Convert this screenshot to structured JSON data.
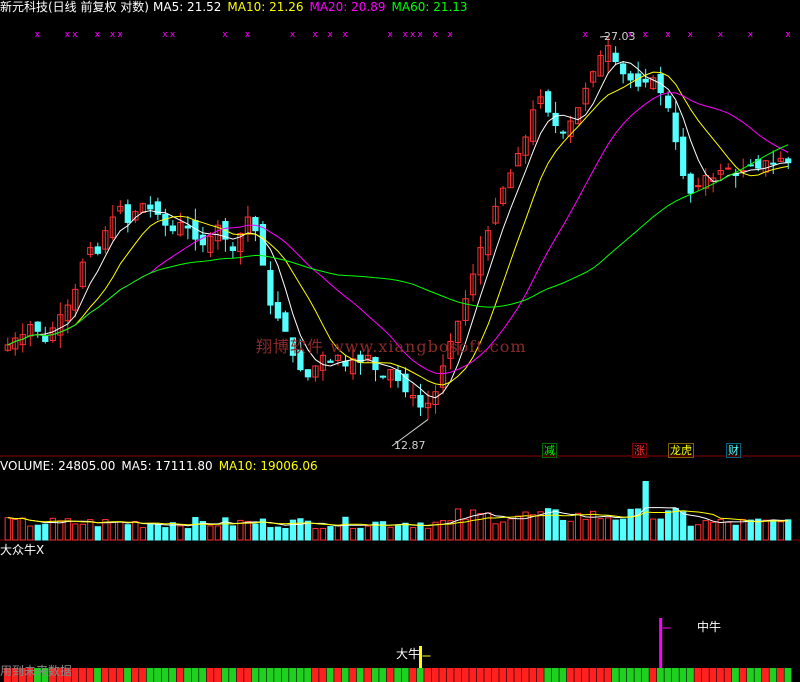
{
  "header": {
    "title": "新元科技(日线 前复权 对数)",
    "ma5": "MA5: 21.52",
    "ma10": "MA10: 21.26",
    "ma20": "MA20: 20.89",
    "ma60": "MA60: 21.13"
  },
  "colors": {
    "up": "#ff3232",
    "down": "#54ffff",
    "ma5": "#ffffff",
    "ma10": "#ffff00",
    "ma20": "#ff00ff",
    "ma60": "#00ff00",
    "signal_x": "#ff00ff",
    "bg": "#000000",
    "grid": "#8b0000"
  },
  "annotations": {
    "high_label": "27.03",
    "low_label": "12.87",
    "events": [
      "减",
      "涨",
      "龙虎",
      "财"
    ]
  },
  "watermark": "翔博软件 www.xiangbosoft.com",
  "volume_header": {
    "volume": "VOLUME: 24805.00",
    "ma5": "MA5: 17111.80",
    "ma10": "MA10: 19006.06"
  },
  "indicator": {
    "title": "大众牛X",
    "signal1": "大牛",
    "signal2": "中牛",
    "bottom_left": "用到未来数据"
  },
  "chart_data": {
    "type": "candlestick",
    "price_range": [
      12.87,
      27.03
    ],
    "price_scale": "log",
    "close_series": [
      15.2,
      15.4,
      15.5,
      15.8,
      15.6,
      15.3,
      15.7,
      16.1,
      16.4,
      16.9,
      17.8,
      18.3,
      18.1,
      18.9,
      19.4,
      19.8,
      19.2,
      19.6,
      19.9,
      19.7,
      19.5,
      19.1,
      18.9,
      19.2,
      19.0,
      18.6,
      18.4,
      18.7,
      19.1,
      18.6,
      18.2,
      18.8,
      19.4,
      18.9,
      17.7,
      16.4,
      16.0,
      15.6,
      14.9,
      14.5,
      14.3,
      14.6,
      14.9,
      14.7,
      14.9,
      14.6,
      14.8,
      14.7,
      14.9,
      14.5,
      14.3,
      14.5,
      14.2,
      13.9,
      13.8,
      13.5,
      13.6,
      13.9,
      14.6,
      15.3,
      15.9,
      16.6,
      17.4,
      18.3,
      18.9,
      19.8,
      20.5,
      21.1,
      21.9,
      22.6,
      23.8,
      24.4,
      23.7,
      23.1,
      22.8,
      23.3,
      23.9,
      24.8,
      25.6,
      26.4,
      26.9,
      26.1,
      25.5,
      25.2,
      24.9,
      25.1,
      25.3,
      24.6,
      23.9,
      22.4,
      21.0,
      20.3,
      20.6,
      21.0,
      20.9,
      21.2,
      21.3,
      21.0,
      21.2,
      21.4,
      21.3,
      21.6,
      21.5,
      21.7,
      21.52
    ],
    "volume_range": [
      0,
      80000
    ],
    "volume_last": 24805,
    "signals": [
      {
        "name": "大牛",
        "index": 55
      },
      {
        "name": "中牛",
        "index": 87
      }
    ]
  }
}
